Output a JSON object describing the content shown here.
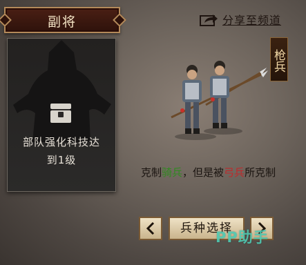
{
  "header": {
    "title": "副将"
  },
  "share": {
    "label": "分享至频道",
    "icon": "share-icon"
  },
  "card": {
    "lock_line1": "部队强化科技达",
    "lock_line2": "到1级",
    "icon": "lock-chest-icon"
  },
  "unit": {
    "type": "枪兵"
  },
  "description": {
    "part1": "克制",
    "counter": "骑兵",
    "part2": "，但是被",
    "weak": "弓兵",
    "part3": "所克制",
    "colors": {
      "counter": "#2f8a1f",
      "weak": "#c0282a"
    }
  },
  "controls": {
    "select_label": "兵种选择",
    "prev_icon": "chevron-left-icon",
    "next_icon": "chevron-right-icon"
  },
  "watermark": {
    "text": "PP助手"
  }
}
